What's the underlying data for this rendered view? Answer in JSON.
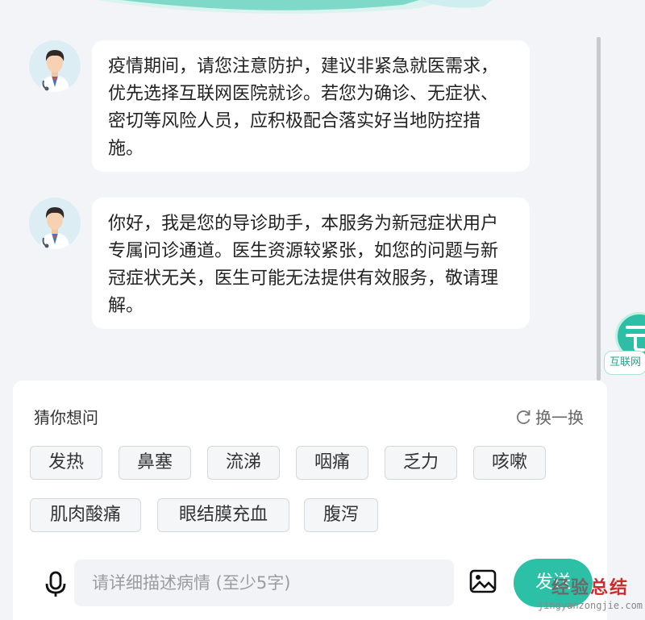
{
  "messages": [
    {
      "text": "疫情期间，请您注意防护，建议非紧急就医需求，优先选择互联网医院就诊。若您为确诊、无症状、密切等风险人员，应积极配合落实好当地防控措施。"
    },
    {
      "text": "你好，我是您的导诊助手，本服务为新冠症状用户专属问诊通道。医生资源较紧张，如您的问题与新冠症状无关，医生可能无法提供有效服务，敬请理解。"
    }
  ],
  "side_float": {
    "label": "互联网"
  },
  "suggestions": {
    "title": "猜你想问",
    "refresh_label": "换一换",
    "chips": [
      "发热",
      "鼻塞",
      "流涕",
      "咽痛",
      "乏力",
      "咳嗽",
      "肌肉酸痛",
      "眼结膜充血",
      "腹泻"
    ]
  },
  "input": {
    "placeholder": "请详细描述病情 (至少5字)",
    "value": "",
    "send_label": "发送"
  },
  "watermark": {
    "main_left": "经验",
    "main_right": "总结",
    "sub": "jingyanzongjie.com"
  },
  "colors": {
    "accent": "#2cc0a6",
    "background": "#f2f4f7",
    "bubble": "#ffffff"
  },
  "icons": {
    "mic": "microphone-icon",
    "image": "image-icon",
    "refresh": "refresh-icon"
  }
}
